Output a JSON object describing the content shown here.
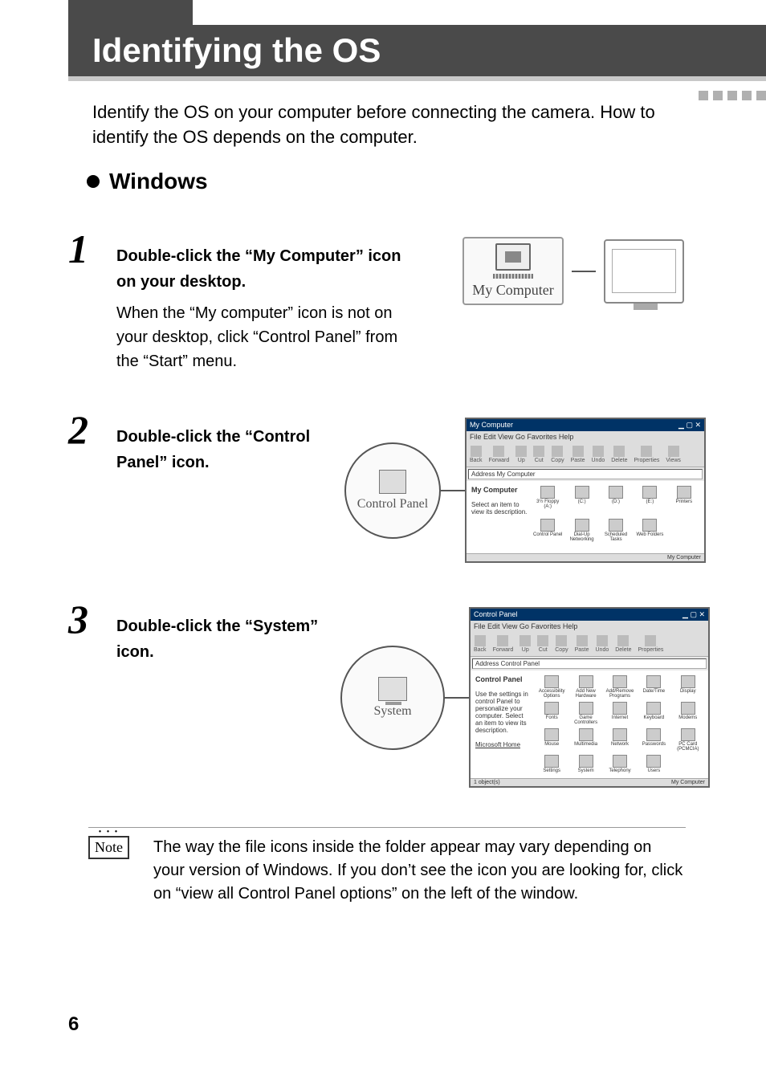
{
  "header": {
    "title": "Identifying the OS"
  },
  "intro": "Identify the OS on your computer before connecting the camera. How to identify the OS depends on the computer.",
  "section": {
    "heading": "Windows"
  },
  "steps": [
    {
      "num": "1",
      "title": "Double-click the “My Computer” icon on your desktop.",
      "desc": "When the “My computer” icon is not on your desktop, click “Control Panel” from the  “Start” menu.",
      "icon_label": "My Computer"
    },
    {
      "num": "2",
      "title": "Double-click the “Control Panel” icon.",
      "callout_label": "Control Panel",
      "window": {
        "title": "My Computer",
        "menu": "File  Edit  View  Go  Favorites  Help",
        "toolbar": [
          "Back",
          "Forward",
          "Up",
          "Cut",
          "Copy",
          "Paste",
          "Undo",
          "Delete",
          "Properties",
          "Views"
        ],
        "address": "My Computer",
        "side_title": "My Computer",
        "side_desc": "Select an item to view its description.",
        "icons": [
          "3½ Floppy (A:)",
          "(C:)",
          "(D:)",
          "(E:)",
          "Printers",
          "Control Panel",
          "Dial-Up Networking",
          "Scheduled Tasks",
          "Web Folders"
        ],
        "status_right": "My Computer"
      }
    },
    {
      "num": "3",
      "title": "Double-click the “System” icon.",
      "callout_label": "System",
      "window": {
        "title": "Control Panel",
        "menu": "File  Edit  View  Go  Favorites  Help",
        "toolbar": [
          "Back",
          "Forward",
          "Up",
          "Cut",
          "Copy",
          "Paste",
          "Undo",
          "Delete",
          "Properties"
        ],
        "address": "Control Panel",
        "side_title": "Control Panel",
        "side_desc": "Use the settings in control Panel to personalize your computer. Select an item to view its description.",
        "side_link": "Microsoft Home",
        "icons": [
          "Accessibility Options",
          "Add New Hardware",
          "Add/Remove Programs",
          "Date/Time",
          "Display",
          "Fonts",
          "Game Controllers",
          "Internet",
          "Keyboard",
          "Modems",
          "Mouse",
          "Multimedia",
          "Network",
          "Passwords",
          "PC Card (PCMCIA)",
          "Settings",
          "System",
          "Telephony",
          "Users"
        ],
        "status_left": "1 object(s)",
        "status_right": "My Computer"
      }
    }
  ],
  "note": {
    "label": "Note",
    "text": "The way the file icons inside the folder appear may vary depending on your version of Windows. If you don’t see the icon you are looking for, click on “view all Control Panel options” on the left of the window."
  },
  "page_number": "6"
}
